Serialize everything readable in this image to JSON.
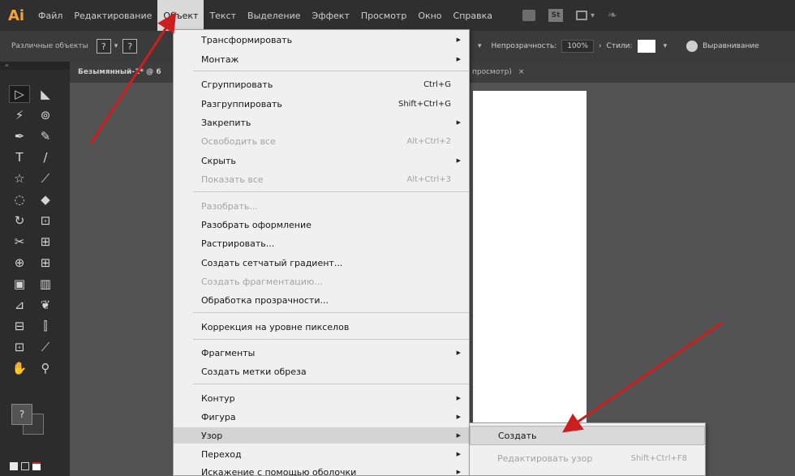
{
  "app": {
    "logo": "Ai"
  },
  "menubar": {
    "items": [
      "Файл",
      "Редактирование",
      "Объект",
      "Текст",
      "Выделение",
      "Эффект",
      "Просмотр",
      "Окно",
      "Справка"
    ],
    "icon_label": "St"
  },
  "controlbar": {
    "selection_label": "Различные объекты",
    "box1": "?",
    "box2": "?",
    "opacity_label": "Непрозрачность:",
    "opacity_value": "100%",
    "styles_label": "Стили:",
    "align_label": "Выравнивание"
  },
  "tabbar": {
    "doc_tab": "Безымянный-1* @ 6",
    "tab2_text": "просмотр)",
    "tab2_close": "×"
  },
  "tools": {
    "header": "«",
    "items": [
      "▷",
      "◣",
      "⚡",
      "⊚",
      "✒",
      "✎",
      "T",
      "/",
      "☆",
      "⟋",
      "◌",
      "◆",
      "↻",
      "⊡",
      "✂",
      "⊞",
      "⊕",
      "⊞",
      "▣",
      "▥",
      "⊿",
      "❦",
      "⊟",
      "⫿",
      "⊡",
      "⟋",
      "✋",
      "⚲"
    ],
    "color_box": "?"
  },
  "object_menu": {
    "items": [
      {
        "label": "Трансформировать",
        "shortcut": "",
        "submenu": true,
        "disabled": false
      },
      {
        "label": "Монтаж",
        "shortcut": "",
        "submenu": true,
        "disabled": false
      },
      {
        "label": "Сгруппировать",
        "shortcut": "Ctrl+G",
        "submenu": false,
        "disabled": false
      },
      {
        "label": "Разгруппировать",
        "shortcut": "Shift+Ctrl+G",
        "submenu": false,
        "disabled": false
      },
      {
        "label": "Закрепить",
        "shortcut": "",
        "submenu": true,
        "disabled": false
      },
      {
        "label": "Освободить все",
        "shortcut": "Alt+Ctrl+2",
        "submenu": false,
        "disabled": true
      },
      {
        "label": "Скрыть",
        "shortcut": "",
        "submenu": true,
        "disabled": false
      },
      {
        "label": "Показать все",
        "shortcut": "Alt+Ctrl+3",
        "submenu": false,
        "disabled": true
      },
      {
        "label": "Разобрать...",
        "shortcut": "",
        "submenu": false,
        "disabled": true
      },
      {
        "label": "Разобрать оформление",
        "shortcut": "",
        "submenu": false,
        "disabled": false
      },
      {
        "label": "Растрировать...",
        "shortcut": "",
        "submenu": false,
        "disabled": false
      },
      {
        "label": "Создать сетчатый градиент...",
        "shortcut": "",
        "submenu": false,
        "disabled": false
      },
      {
        "label": "Создать фрагментацию...",
        "shortcut": "",
        "submenu": false,
        "disabled": true
      },
      {
        "label": "Обработка прозрачности...",
        "shortcut": "",
        "submenu": false,
        "disabled": false
      },
      {
        "label": "Коррекция на уровне пикселов",
        "shortcut": "",
        "submenu": false,
        "disabled": false
      },
      {
        "label": "Фрагменты",
        "shortcut": "",
        "submenu": true,
        "disabled": false
      },
      {
        "label": "Создать метки обреза",
        "shortcut": "",
        "submenu": false,
        "disabled": false
      },
      {
        "label": "Контур",
        "shortcut": "",
        "submenu": true,
        "disabled": false
      },
      {
        "label": "Фигура",
        "shortcut": "",
        "submenu": true,
        "disabled": false
      },
      {
        "label": "Узор",
        "shortcut": "",
        "submenu": true,
        "disabled": false
      },
      {
        "label": "Переход",
        "shortcut": "",
        "submenu": true,
        "disabled": false
      },
      {
        "label": "Искажение с помощью оболочки",
        "shortcut": "",
        "submenu": true,
        "disabled": false
      }
    ]
  },
  "pattern_submenu": {
    "items": [
      {
        "label": "Создать",
        "shortcut": "",
        "disabled": false
      },
      {
        "label": "Редактировать узор",
        "shortcut": "Shift+Ctrl+F8",
        "disabled": true
      },
      {
        "label": "",
        "shortcut": "",
        "disabled": true
      }
    ]
  },
  "colors": {
    "menubar_bg": "#2f2f2f",
    "canvas_bg": "#535353",
    "menu_bg": "#f0f0f0",
    "annotation_red": "#cc1e1e",
    "logo_orange": "#f3a33a"
  }
}
